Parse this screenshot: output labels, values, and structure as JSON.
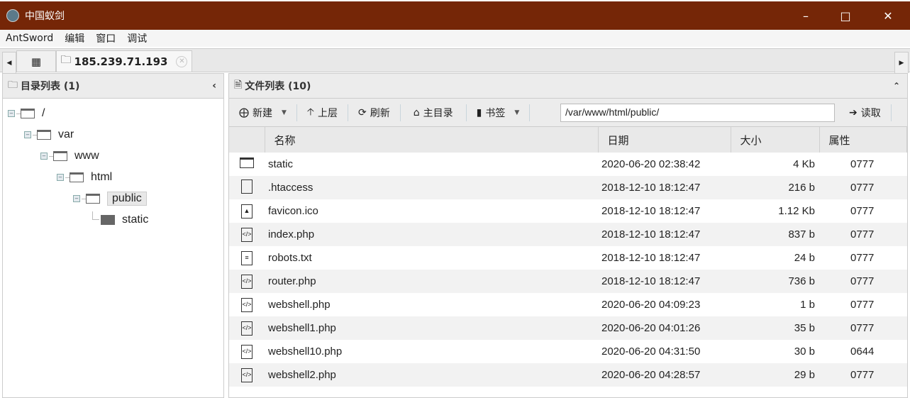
{
  "window": {
    "title": "中国蚁剑",
    "colors": {
      "titlebar": "#752607"
    }
  },
  "menu": [
    "AntSword",
    "编辑",
    "窗口",
    "调试"
  ],
  "tabs": {
    "active_tab": "185.239.71.193"
  },
  "left": {
    "title": "目录列表 (1)",
    "tree": [
      {
        "label": "/",
        "level": 0
      },
      {
        "label": "var",
        "level": 1
      },
      {
        "label": "www",
        "level": 2
      },
      {
        "label": "html",
        "level": 3
      },
      {
        "label": "public",
        "level": 4,
        "selected": true
      },
      {
        "label": "static",
        "level": 5,
        "filled": true
      }
    ]
  },
  "right": {
    "title": "文件列表 (10)",
    "toolbar": {
      "new": "新建",
      "up": "上层",
      "refresh": "刷新",
      "home": "主目录",
      "bookmark": "书签",
      "path": "/var/www/html/public/",
      "read": "读取"
    },
    "columns": [
      "名称",
      "日期",
      "大小",
      "属性"
    ],
    "rows": [
      {
        "icon": "folder",
        "name": "static",
        "date": "2020-06-20 02:38:42",
        "size": "4 Kb",
        "perm": "0777"
      },
      {
        "icon": "file",
        "name": ".htaccess",
        "date": "2018-12-10 18:12:47",
        "size": "216 b",
        "perm": "0777"
      },
      {
        "icon": "image",
        "name": "favicon.ico",
        "date": "2018-12-10 18:12:47",
        "size": "1.12 Kb",
        "perm": "0777"
      },
      {
        "icon": "code",
        "name": "index.php",
        "date": "2018-12-10 18:12:47",
        "size": "837 b",
        "perm": "0777"
      },
      {
        "icon": "text",
        "name": "robots.txt",
        "date": "2018-12-10 18:12:47",
        "size": "24 b",
        "perm": "0777"
      },
      {
        "icon": "code",
        "name": "router.php",
        "date": "2018-12-10 18:12:47",
        "size": "736 b",
        "perm": "0777"
      },
      {
        "icon": "code",
        "name": "webshell.php",
        "date": "2020-06-20 04:09:23",
        "size": "1 b",
        "perm": "0777"
      },
      {
        "icon": "code",
        "name": "webshell1.php",
        "date": "2020-06-20 04:01:26",
        "size": "35 b",
        "perm": "0777"
      },
      {
        "icon": "code",
        "name": "webshell10.php",
        "date": "2020-06-20 04:31:50",
        "size": "30 b",
        "perm": "0644"
      },
      {
        "icon": "code",
        "name": "webshell2.php",
        "date": "2020-06-20 04:28:57",
        "size": "29 b",
        "perm": "0777"
      }
    ]
  }
}
